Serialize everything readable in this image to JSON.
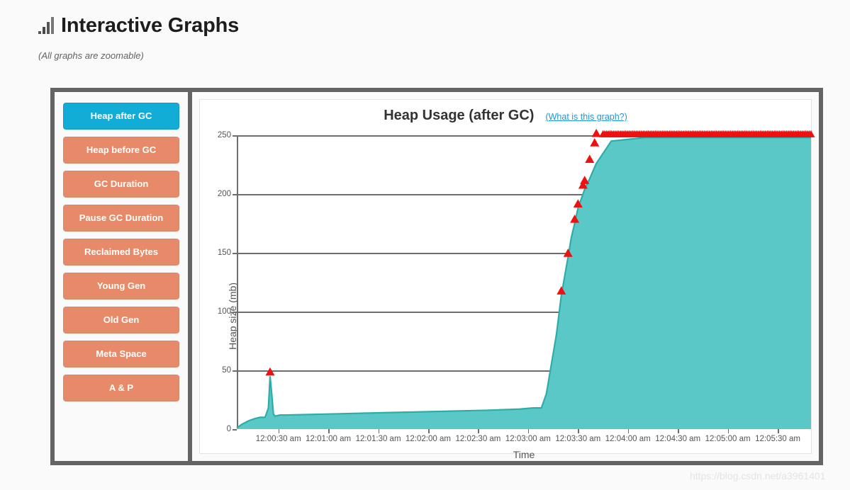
{
  "header": {
    "title": "Interactive Graphs",
    "subtitle": "(All graphs are zoomable)",
    "icon": "bar-chart-icon"
  },
  "sidebar": {
    "items": [
      {
        "label": "Heap after GC",
        "active": true
      },
      {
        "label": "Heap before GC",
        "active": false
      },
      {
        "label": "GC Duration",
        "active": false
      },
      {
        "label": "Pause GC Duration",
        "active": false
      },
      {
        "label": "Reclaimed Bytes",
        "active": false
      },
      {
        "label": "Young Gen",
        "active": false
      },
      {
        "label": "Old Gen",
        "active": false
      },
      {
        "label": "Meta Space",
        "active": false
      },
      {
        "label": "A & P",
        "active": false
      }
    ]
  },
  "chart_panel": {
    "title": "Heap Usage (after GC)",
    "help_link": "(What is this graph?)"
  },
  "colors": {
    "accent_active": "#11ADD6",
    "button": "#E78A69",
    "series_fill": "#5BC8C8",
    "series_line": "#2EADA8",
    "marker": "#EE1111",
    "frame": "#646464",
    "axis": "#6D6D6D",
    "link": "#2196D4"
  },
  "watermark": "https://blog.csdn.net/a3961401",
  "chart_data": {
    "type": "area",
    "title": "Heap Usage (after GC)",
    "xlabel": "Time",
    "ylabel": "Heap size (mb)",
    "grid": true,
    "legend": false,
    "ylim": [
      0,
      250
    ],
    "yticks": [
      0,
      50,
      100,
      150,
      200,
      250
    ],
    "ytick_labels": [
      "0",
      "50",
      "100",
      "150",
      "200",
      "250"
    ],
    "xlim_seconds": [
      0,
      345
    ],
    "xticks_seconds": [
      25,
      55,
      85,
      115,
      145,
      175,
      205,
      235,
      265,
      295,
      325
    ],
    "xtick_labels": [
      "12:00:30 am",
      "12:01:00 am",
      "12:01:30 am",
      "12:02:00 am",
      "12:02:30 am",
      "12:03:00 am",
      "12:03:30 am",
      "12:04:00 am",
      "12:04:30 am",
      "12:05:00 am",
      "12:05:30 am"
    ],
    "series": [
      {
        "name": "Heap after GC",
        "fill": "#5BC8C8",
        "line": "#2EADA8",
        "unit": "mb",
        "x": [
          0,
          3,
          7,
          11,
          14,
          17,
          19,
          20,
          21,
          22,
          23,
          26,
          30,
          60,
          90,
          120,
          150,
          170,
          178,
          183,
          186,
          189,
          192,
          195,
          197,
          199,
          201,
          203,
          205,
          207,
          209,
          212,
          216,
          225,
          245,
          265,
          285,
          305,
          325,
          345
        ],
        "y": [
          1,
          4,
          7,
          9,
          10,
          10,
          18,
          45,
          30,
          13,
          11,
          12,
          12,
          13,
          14,
          15,
          16,
          17,
          18,
          18,
          30,
          55,
          80,
          114,
          130,
          146,
          163,
          175,
          188,
          196,
          204,
          213,
          226,
          245,
          248,
          248,
          248,
          248,
          248,
          248
        ]
      }
    ],
    "markers": {
      "name": "gc-event-markers",
      "symbol": "triangle-up",
      "color": "#EE1111",
      "points": [
        {
          "x": 20,
          "y": 45
        },
        {
          "x": 195,
          "y": 114
        },
        {
          "x": 199,
          "y": 146
        },
        {
          "x": 203,
          "y": 175
        },
        {
          "x": 205,
          "y": 188
        },
        {
          "x": 208,
          "y": 204
        },
        {
          "x": 209,
          "y": 208
        },
        {
          "x": 212,
          "y": 226
        },
        {
          "x": 215,
          "y": 240
        },
        {
          "x": 216,
          "y": 248
        }
      ],
      "plateau_band": {
        "description": "dense overlapping markers along plateau",
        "x_start": 220,
        "x_end": 345,
        "y": 248,
        "count": 120
      }
    }
  }
}
